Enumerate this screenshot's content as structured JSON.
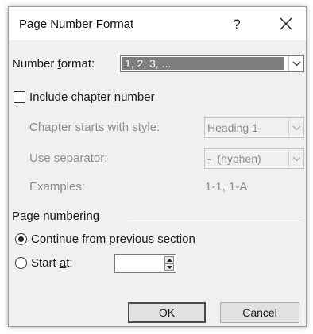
{
  "dialog": {
    "title": "Page Number Format",
    "help_label": "?",
    "close_icon": "close-icon"
  },
  "number_format": {
    "label_pre": "Number ",
    "label_accel": "f",
    "label_post": "ormat:",
    "selected_value": "1, 2, 3, ..."
  },
  "include_chapter": {
    "label_pre": "Include chapter ",
    "label_accel": "n",
    "label_post": "umber",
    "checked": false
  },
  "chapter_style": {
    "label": "Chapter starts with style:",
    "value": "Heading 1"
  },
  "separator": {
    "label": "Use separator:",
    "value": "-  (hyphen)"
  },
  "examples": {
    "label": "Examples:",
    "value": "1-1, 1-A"
  },
  "page_numbering": {
    "group_label": "Page numbering",
    "continue_accel": "C",
    "continue_rest": "ontinue from previous section",
    "continue_selected": true,
    "start_pre": "Start ",
    "start_accel": "a",
    "start_post": "t:",
    "start_value": ""
  },
  "buttons": {
    "ok_label": "OK",
    "cancel_label": "Cancel"
  }
}
